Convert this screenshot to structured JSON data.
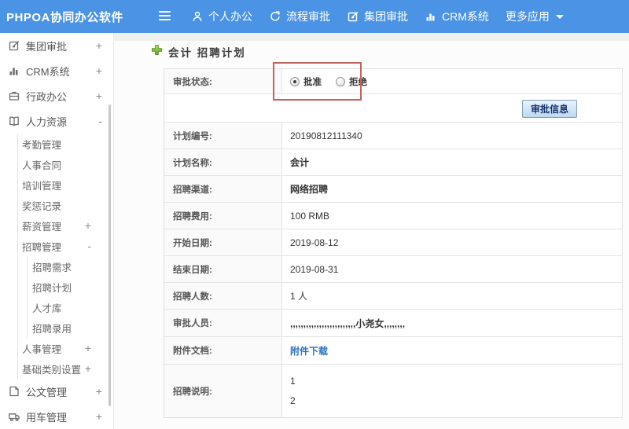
{
  "header": {
    "logo_title": "PHPOA协同办公软件",
    "nav": [
      {
        "label": "个人办公",
        "icon": "person-icon"
      },
      {
        "label": "流程审批",
        "icon": "process-icon"
      },
      {
        "label": "集团审批",
        "icon": "edit-icon"
      },
      {
        "label": "CRM系统",
        "icon": "chart-icon"
      },
      {
        "label": "更多应用",
        "icon": "caret-down-icon"
      }
    ]
  },
  "sidebar": {
    "items": [
      {
        "label": "集团审批",
        "expander": "+",
        "icon": "edit-icon"
      },
      {
        "label": "CRM系统",
        "expander": "+",
        "icon": "chart-icon"
      },
      {
        "label": "行政办公",
        "expander": "+",
        "icon": "briefcase-icon"
      },
      {
        "label": "人力资源",
        "expander": "-",
        "icon": "book-icon"
      },
      {
        "label": "考勤管理",
        "expander": ""
      },
      {
        "label": "人事合同",
        "expander": ""
      },
      {
        "label": "培训管理",
        "expander": ""
      },
      {
        "label": "奖惩记录",
        "expander": ""
      },
      {
        "label": "薪资管理",
        "expander": "+"
      },
      {
        "label": "招聘管理",
        "expander": "-"
      },
      {
        "label": "招聘需求",
        "expander": ""
      },
      {
        "label": "招聘计划",
        "expander": ""
      },
      {
        "label": "人才库",
        "expander": ""
      },
      {
        "label": "招聘录用",
        "expander": ""
      },
      {
        "label": "人事管理",
        "expander": "+"
      },
      {
        "label": "基础类别设置",
        "expander": "+"
      },
      {
        "label": "公文管理",
        "expander": "+",
        "icon": "doc-icon"
      },
      {
        "label": "用车管理",
        "expander": "+",
        "icon": "truck-icon"
      }
    ]
  },
  "content": {
    "page_title": "会计 招聘计划",
    "form": {
      "status_label": "审批状态:",
      "radio_approve": {
        "label": "批准",
        "selected": true
      },
      "radio_reject": {
        "label": "拒绝",
        "selected": false
      },
      "approve_info_button": "审批信息",
      "rows": [
        {
          "label": "计划编号:",
          "value": "20190812111340"
        },
        {
          "label": "计划名称:",
          "value": "会计"
        },
        {
          "label": "招聘渠道:",
          "value": "网络招聘"
        },
        {
          "label": "招聘费用:",
          "value": "100 RMB"
        },
        {
          "label": "开始日期:",
          "value": "2019-08-12"
        },
        {
          "label": "结束日期:",
          "value": "2019-08-31"
        },
        {
          "label": "招聘人数:",
          "value": "1 人"
        },
        {
          "label": "审批人员:",
          "value": ",,,,,,,,,,,,,,,,,,,,,,,,,小尧女,,,,,,,,"
        },
        {
          "label": "附件文档:",
          "value": "附件下载"
        },
        {
          "label": "招聘说明:",
          "lines": [
            "1",
            "2"
          ]
        }
      ]
    }
  },
  "colors": {
    "header_blue": "#4b93e4",
    "annotation_red": "#c4625f",
    "link_blue": "#2f74c0",
    "plus_green": "#6fb13a"
  },
  "icons": {
    "person-icon": "user silhouette",
    "process-icon": "circular workflow arrow",
    "edit-icon": "pen over square",
    "chart-icon": "bar chart",
    "caret-down-icon": "dropdown triangle",
    "briefcase-icon": "briefcase",
    "book-icon": "open book",
    "doc-icon": "document with folded corner",
    "truck-icon": "truck",
    "plus-icon": "green glossy plus",
    "hamburger-icon": "menu bars"
  }
}
